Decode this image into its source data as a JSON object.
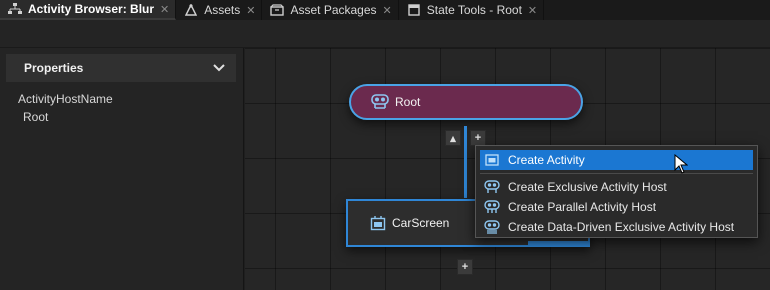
{
  "tabs": [
    {
      "label": "Activity Browser: Blur",
      "icon": "activity-tree-icon",
      "active": true
    },
    {
      "label": "Assets",
      "icon": "assets-icon",
      "active": false
    },
    {
      "label": "Asset Packages",
      "icon": "package-icon",
      "active": false
    },
    {
      "label": "State Tools - Root",
      "icon": "document-icon",
      "active": false
    }
  ],
  "properties": {
    "title": "Properties",
    "fields": [
      {
        "name": "ActivityHostName",
        "value": "Root"
      }
    ]
  },
  "graph": {
    "root_node": {
      "label": "Root",
      "icon": "activity-host-icon"
    },
    "child_node": {
      "label": "CarScreen",
      "icon": "activity-icon"
    },
    "collapse_glyph": "▴",
    "add_glyph": "+"
  },
  "context_menu": {
    "items": [
      {
        "label": "Create Activity",
        "icon": "activity-icon",
        "highlighted": true
      },
      {
        "label": "Create Exclusive Activity Host",
        "icon": "exclusive-host-icon",
        "highlighted": false
      },
      {
        "label": "Create Parallel Activity Host",
        "icon": "parallel-host-icon",
        "highlighted": false
      },
      {
        "label": "Create Data-Driven Exclusive Activity Host",
        "icon": "data-driven-host-icon",
        "highlighted": false
      }
    ]
  },
  "colors": {
    "accent_blue": "#2f86d6",
    "menu_highlight": "#1b77d2",
    "root_node_fill": "#6b2a4e"
  }
}
